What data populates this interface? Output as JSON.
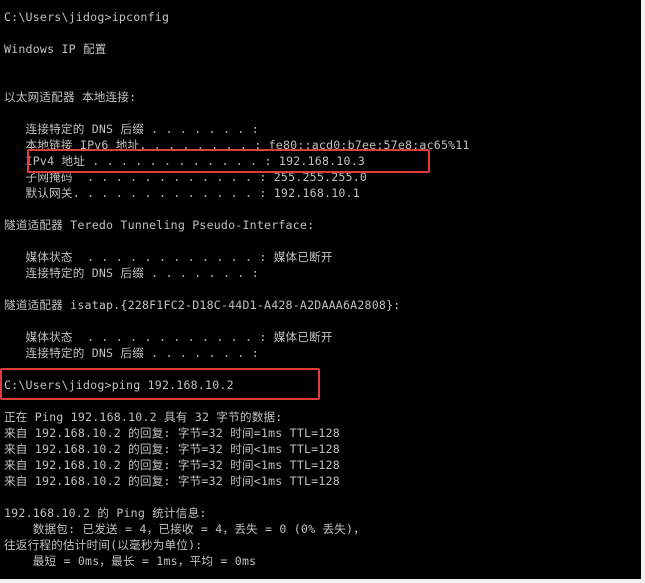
{
  "lines": {
    "l01": "C:\\Users\\jidog>ipconfig",
    "l02": "Windows IP 配置",
    "l03": "以太网适配器 本地连接:",
    "l04": "   连接特定的 DNS 后缀 . . . . . . . :",
    "l05": "   本地链接 IPv6 地址. . . . . . . . : fe80::acd0:b7ee:57e8:ac65%11",
    "l06": "   IPv4 地址 . . . . . . . . . . . . : 192.168.10.3",
    "l07": "   子网掩码  . . . . . . . . . . . . : 255.255.255.0",
    "l08": "   默认网关. . . . . . . . . . . . . : 192.168.10.1",
    "l09": "隧道适配器 Teredo Tunneling Pseudo-Interface:",
    "l10": "   媒体状态  . . . . . . . . . . . . : 媒体已断开",
    "l11": "   连接特定的 DNS 后缀 . . . . . . . :",
    "l12": "隧道适配器 isatap.{228F1FC2-D18C-44D1-A428-A2DAAA6A2808}:",
    "l13": "   媒体状态  . . . . . . . . . . . . : 媒体已断开",
    "l14": "   连接特定的 DNS 后缀 . . . . . . . :",
    "l15": "C:\\Users\\jidog>ping 192.168.10.2",
    "l16": "正在 Ping 192.168.10.2 具有 32 字节的数据:",
    "l17": "来自 192.168.10.2 的回复: 字节=32 时间=1ms TTL=128",
    "l18": "来自 192.168.10.2 的回复: 字节=32 时间<1ms TTL=128",
    "l19": "来自 192.168.10.2 的回复: 字节=32 时间<1ms TTL=128",
    "l20": "来自 192.168.10.2 的回复: 字节=32 时间<1ms TTL=128",
    "l21": "192.168.10.2 的 Ping 统计信息:",
    "l22": "    数据包: 已发送 = 4，已接收 = 4，丢失 = 0 (0% 丢失)，",
    "l23": "往返行程的估计时间(以毫秒为单位):",
    "l24": "    最短 = 0ms，最长 = 1ms，平均 = 0ms"
  },
  "colors": {
    "console_bg": "#000000",
    "console_text": "#c0c0c0",
    "highlight_border": "#e03c3c"
  }
}
